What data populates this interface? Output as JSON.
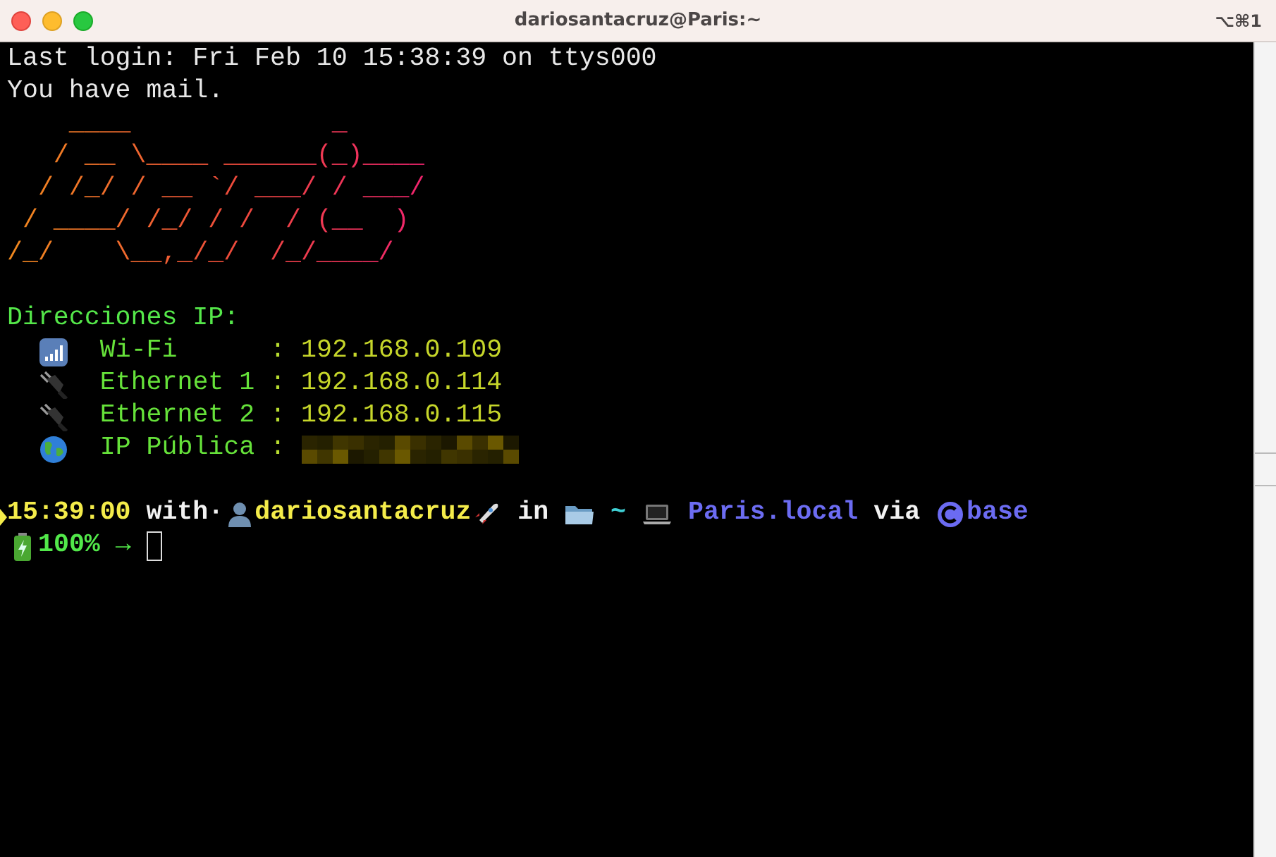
{
  "window": {
    "title": "dariosantacruz@Paris:~",
    "shortcut": "⌥⌘1"
  },
  "login_lines": [
    "Last login: Fri Feb 10 15:38:39 on ttys000",
    "You have mail."
  ],
  "banner": [
    "    ____             _",
    "   / __ \\____ ______(_)____",
    "  / /_/ / __ `/ ___/ / ___/",
    " / ____/ /_/ / /  / (__  )",
    "/_/    \\__,_/_/  /_/____/"
  ],
  "ip_section": {
    "heading": "Direcciones IP:",
    "interfaces": [
      {
        "kind": "wifi",
        "name": "Wi-Fi",
        "separator": ":",
        "address": "192.168.0.109"
      },
      {
        "kind": "ethernet",
        "name": "Ethernet 1",
        "separator": ":",
        "address": "192.168.0.114"
      },
      {
        "kind": "ethernet",
        "name": "Ethernet 2",
        "separator": ":",
        "address": "192.168.0.115"
      },
      {
        "kind": "public",
        "name": "IP Pública",
        "separator": ":",
        "redacted": true
      }
    ]
  },
  "prompt": {
    "lines": [
      [
        [
          {
            "kind": "time",
            "text": "15:39:00"
          }
        ],
        [
          {
            "kind": "word",
            "text": "with·"
          },
          {
            "kind": "person-icon"
          },
          {
            "kind": "user",
            "text": "dariosantacruz"
          },
          {
            "kind": "rocket-icon"
          }
        ],
        [
          {
            "kind": "word",
            "text": "in"
          }
        ],
        [
          {
            "kind": "folder-icon"
          }
        ],
        [
          {
            "kind": "dir",
            "text": "~"
          }
        ],
        [
          {
            "kind": "laptop-icon"
          }
        ],
        [
          {
            "kind": "host",
            "text": "Paris.local"
          }
        ],
        [
          {
            "kind": "word",
            "text": "via"
          }
        ],
        [
          {
            "kind": "conda-icon"
          },
          {
            "kind": "env",
            "text": "base"
          }
        ]
      ],
      [
        [
          {
            "kind": "battery-icon"
          },
          {
            "kind": "battery",
            "text": "100%"
          }
        ],
        [
          {
            "kind": "arrow",
            "text": "→"
          }
        ],
        [
          {
            "kind": "cursor"
          }
        ]
      ]
    ]
  }
}
